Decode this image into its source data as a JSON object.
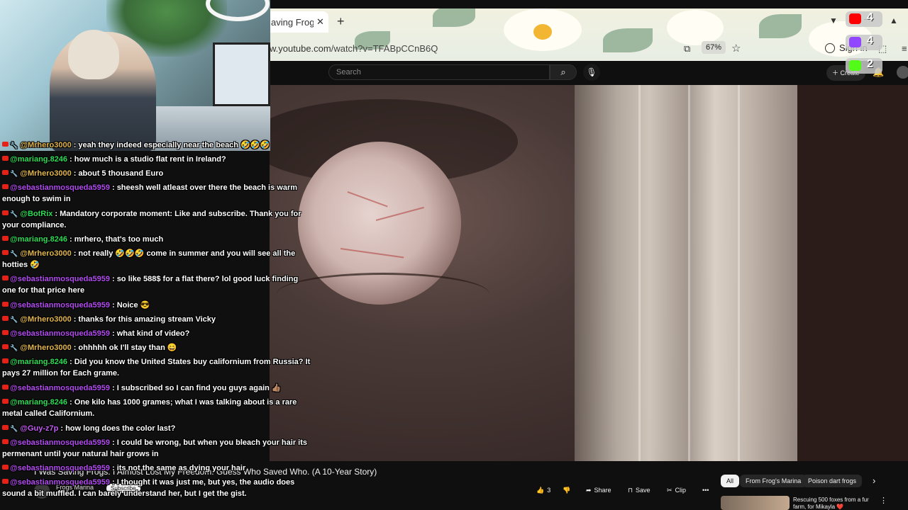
{
  "browser": {
    "tab_title": "aving Frogs",
    "tab_close": "✕",
    "new_tab": "+",
    "url_host": "w.youtube.com",
    "url_path": "/watch?v=TFABpCCnB6Q",
    "zoom": "67%",
    "sign_in": "Sign in"
  },
  "youtube": {
    "search_placeholder": "Search",
    "create_label": "Create",
    "video_title": "I Was Saving Frogs. I Almost Lost My Freedom. Guess Who Saved Who. (A 10-Year Story)",
    "channel_name": "Frogs Marina",
    "subscribe_label": "Subscribe",
    "like_count": "3",
    "share_label": "Share",
    "save_label": "Save",
    "clip_label": "Clip",
    "chips": [
      "All",
      "From Frog's Marina",
      "Poison dart frogs"
    ],
    "recommended": {
      "title": "Rescuing 500 foxes from a fur farm, for Mikayla ❤️"
    }
  },
  "counters": [
    {
      "platform": "youtube-icon",
      "value": "4",
      "color": "#ff0000"
    },
    {
      "platform": "twitch-icon",
      "value": "4",
      "color": "#9146ff"
    },
    {
      "platform": "kick-icon",
      "value": "2",
      "color": "#53fc18"
    }
  ],
  "chat": [
    {
      "user": "@Mrhero3000",
      "mod": true,
      "color": "gold",
      "text": ": yeah they indeed especially near the beach 🤣🤣🤣"
    },
    {
      "user": "@mariang.8246",
      "mod": false,
      "color": "green",
      "text": ": how much is a studio flat rent in Ireland?"
    },
    {
      "user": "@Mrhero3000",
      "mod": true,
      "color": "gold",
      "text": ": about 5 thousand Euro"
    },
    {
      "user": "@sebastianmosqueda5959",
      "mod": false,
      "color": "purple",
      "text": ": sheesh well atleast over there the beach is warm enough to swim in"
    },
    {
      "user": "@BotRix",
      "mod": true,
      "color": "green",
      "text": ": Mandatory corporate moment: Like and subscribe. Thank you for your compliance."
    },
    {
      "user": "@mariang.8246",
      "mod": false,
      "color": "green",
      "text": ": mrhero, that's too much"
    },
    {
      "user": "@Mrhero3000",
      "mod": true,
      "color": "gold",
      "text": ": not really 🤣🤣🤣 come in summer and you will see all the hotties 🤣"
    },
    {
      "user": "@sebastianmosqueda5959",
      "mod": false,
      "color": "purple",
      "text": ": so like 588$ for a flat there? lol good luck finding one for that price here"
    },
    {
      "user": "@sebastianmosqueda5959",
      "mod": false,
      "color": "purple",
      "text": ": Noice 😎"
    },
    {
      "user": "@Mrhero3000",
      "mod": true,
      "color": "gold",
      "text": ": thanks for this amazing stream Vicky"
    },
    {
      "user": "@sebastianmosqueda5959",
      "mod": false,
      "color": "purple",
      "text": ": what kind of video?"
    },
    {
      "user": "@Mrhero3000",
      "mod": true,
      "color": "gold",
      "text": ": ohhhhh ok I'll stay than 😄"
    },
    {
      "user": "@mariang.8246",
      "mod": false,
      "color": "green",
      "text": ": Did you know the United States buy californium from Russia? It pays 27 million for Each grame."
    },
    {
      "user": "@sebastianmosqueda5959",
      "mod": false,
      "color": "purple",
      "text": ": I subscribed so I can find you guys again 👍🏽"
    },
    {
      "user": "@mariang.8246",
      "mod": false,
      "color": "green",
      "text": ": One kilo has 1000 grames; what I was talking about is a rare metal called Californium."
    },
    {
      "user": "@Guy-z7p",
      "mod": true,
      "color": "purple2",
      "text": ": how long does the color last?"
    },
    {
      "user": "@sebastianmosqueda5959",
      "mod": false,
      "color": "purple",
      "text": ": I could be wrong, but when you bleach your hair its permenant until your natural hair grows in"
    },
    {
      "user": "@sebastianmosqueda5959",
      "mod": false,
      "color": "purple",
      "text": ": its not the same as dying your hair"
    },
    {
      "user": "@sebastianmosqueda5959",
      "mod": false,
      "color": "purple",
      "text": ": I thought it was just me, but yes, the audio does sound a bit muffled. I can barely understand her, but I get the gist."
    }
  ]
}
